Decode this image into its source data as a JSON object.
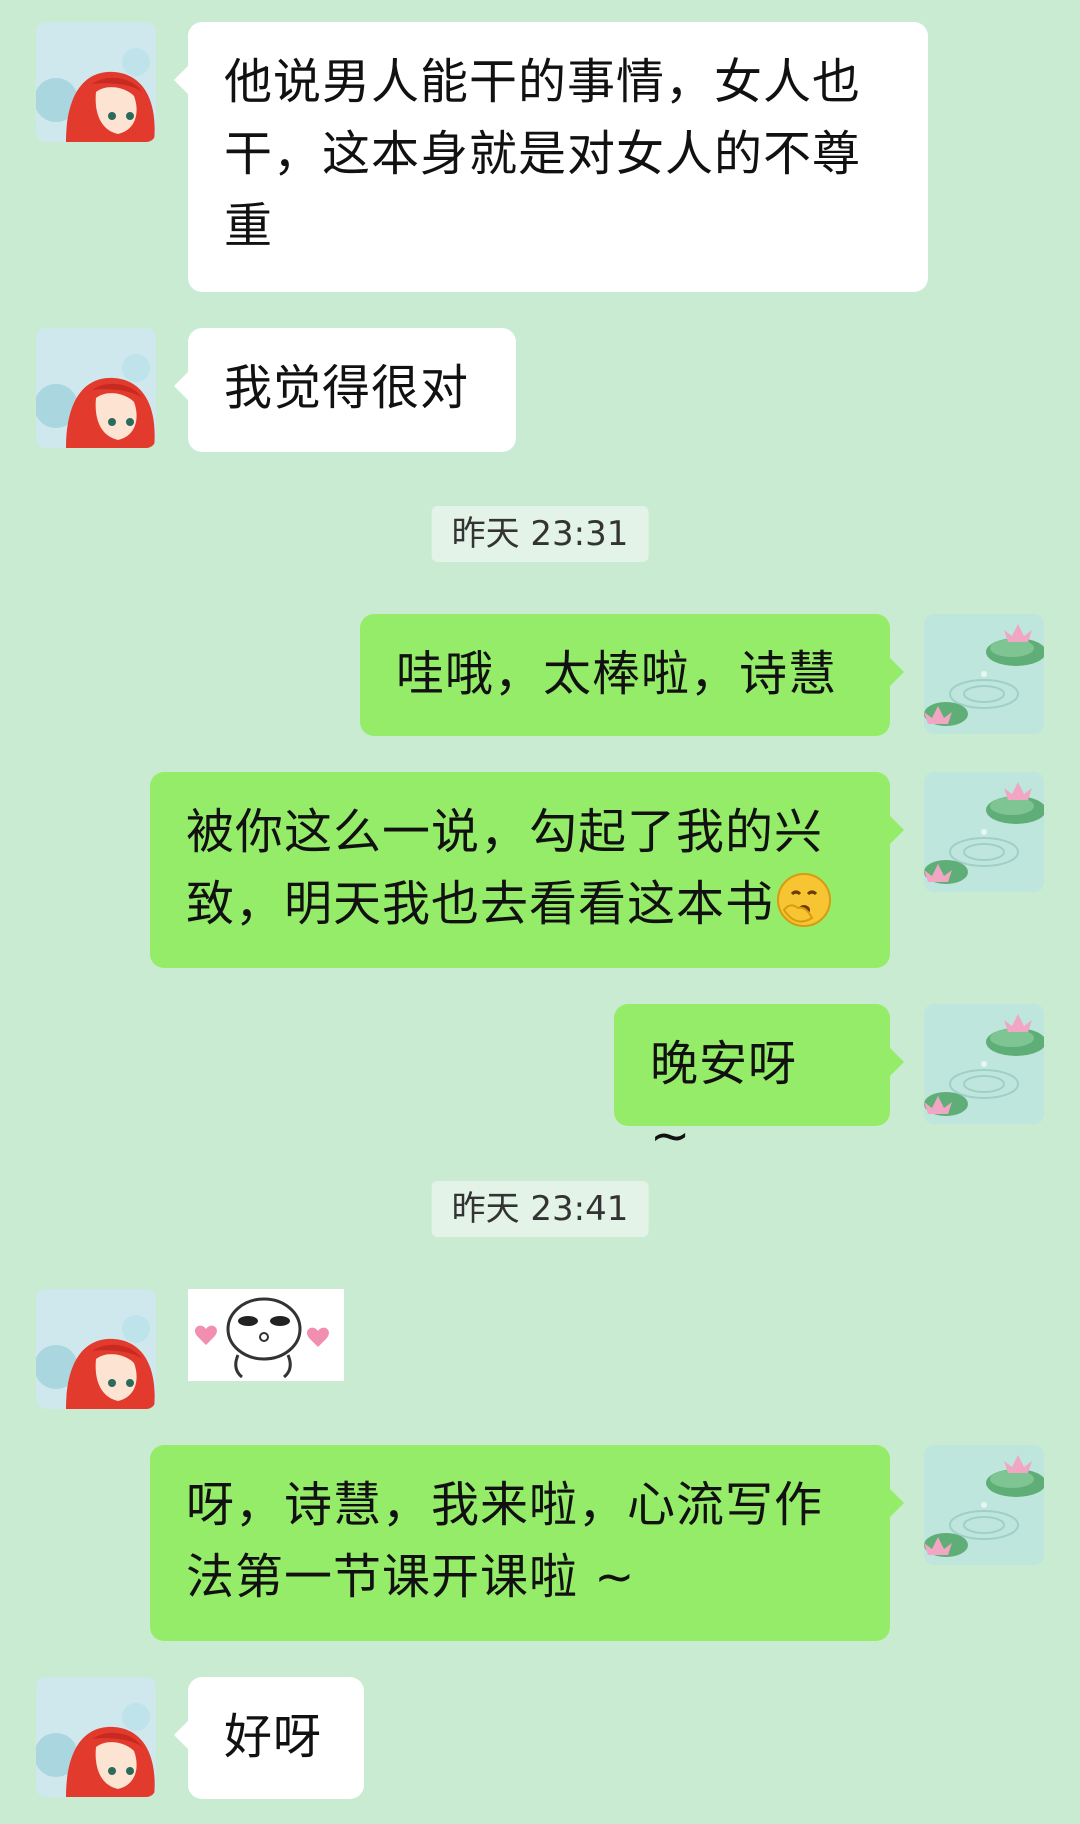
{
  "messages": [
    {
      "side": "left",
      "text": "他说男人能干的事情，女人也干，这本身就是对女人的不尊重",
      "avatar": "red-hair-girl-avatar"
    },
    {
      "side": "left",
      "text": "我觉得很对",
      "avatar": "red-hair-girl-avatar"
    },
    {
      "type": "timestamp",
      "text": "昨天 23:31"
    },
    {
      "side": "right",
      "text": "哇哦，太棒啦，诗慧",
      "avatar": "lotus-pond-avatar"
    },
    {
      "side": "right",
      "text": "被你这么一说，勾起了我的兴致，明天我也去看看这本书",
      "emoji": "yawning-face-emoji",
      "avatar": "lotus-pond-avatar"
    },
    {
      "side": "right",
      "text": "晚安呀 ~",
      "avatar": "lotus-pond-avatar"
    },
    {
      "type": "timestamp",
      "text": "昨天 23:41"
    },
    {
      "side": "left",
      "type": "sticker",
      "sticker": "blob-with-hearts-sticker",
      "avatar": "red-hair-girl-avatar"
    },
    {
      "side": "right",
      "text": "呀，诗慧，我来啦，心流写作法第一节课开课啦 ~",
      "avatar": "lotus-pond-avatar"
    },
    {
      "side": "left",
      "text": "好呀",
      "avatar": "red-hair-girl-avatar"
    }
  ],
  "colors": {
    "background": "#c8ebd2",
    "bubble_left": "#ffffff",
    "bubble_right": "#95ec69",
    "timestamp_bg": "#e3f3e7"
  }
}
